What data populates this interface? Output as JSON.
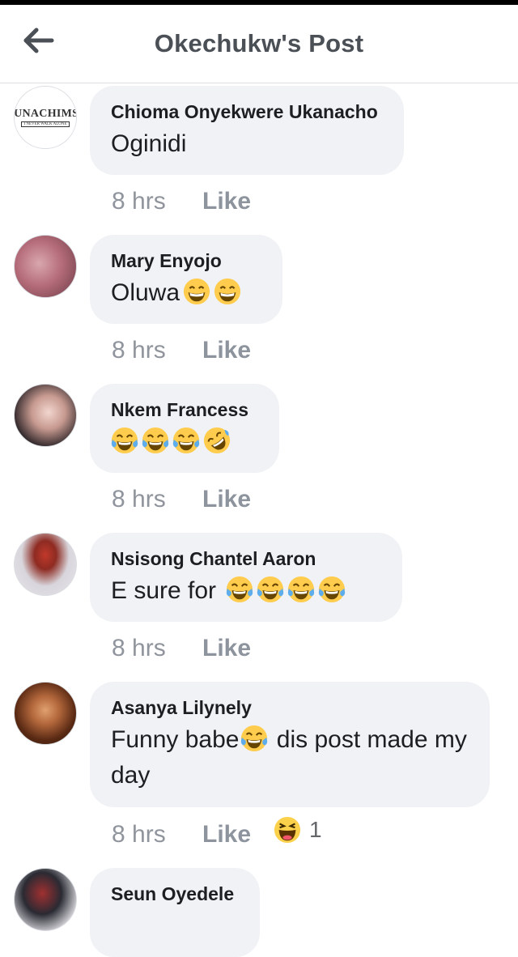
{
  "header": {
    "title": "Okechukw's Post",
    "back_icon": "arrow-left-icon"
  },
  "comments": [
    {
      "author": "Chioma Onyekwere Ukanacho",
      "text": "Oginidi",
      "time": "8 hrs",
      "like": "Like",
      "avatar": {
        "logo_main": "MUNACHIMSO",
        "logo_sub": "I NEVER WALK ALONE"
      }
    },
    {
      "author": "Mary Enyojo",
      "text": "Oluwa",
      "emojis": [
        "grinning-face",
        "grinning-face"
      ],
      "time": "8 hrs",
      "like": "Like"
    },
    {
      "author": "Nkem Francess",
      "text": "",
      "emojis": [
        "face-with-tears-of-joy",
        "face-with-tears-of-joy",
        "face-with-tears-of-joy",
        "rolling-on-floor-laughing"
      ],
      "time": "8 hrs",
      "like": "Like"
    },
    {
      "author": "Nsisong Chantel Aaron",
      "text": "E sure for ",
      "emojis": [
        "face-with-tears-of-joy",
        "face-with-tears-of-joy",
        "face-with-tears-of-joy",
        "face-with-tears-of-joy"
      ],
      "time": "8 hrs",
      "like": "Like"
    },
    {
      "author": "Asanya Lilynely",
      "text_before": "Funny babe",
      "emoji_inline": "face-with-tears-of-joy",
      "text_after": " dis post made my day",
      "time": "8 hrs",
      "like": "Like",
      "reaction": {
        "icon": "haha-reaction",
        "count": "1"
      }
    },
    {
      "author": "Seun Oyedele"
    }
  ],
  "colors": {
    "bubble": "#f0f2f5",
    "meta": "#90949c",
    "title": "#4b4f56",
    "emoji": "#ffcc4d"
  }
}
